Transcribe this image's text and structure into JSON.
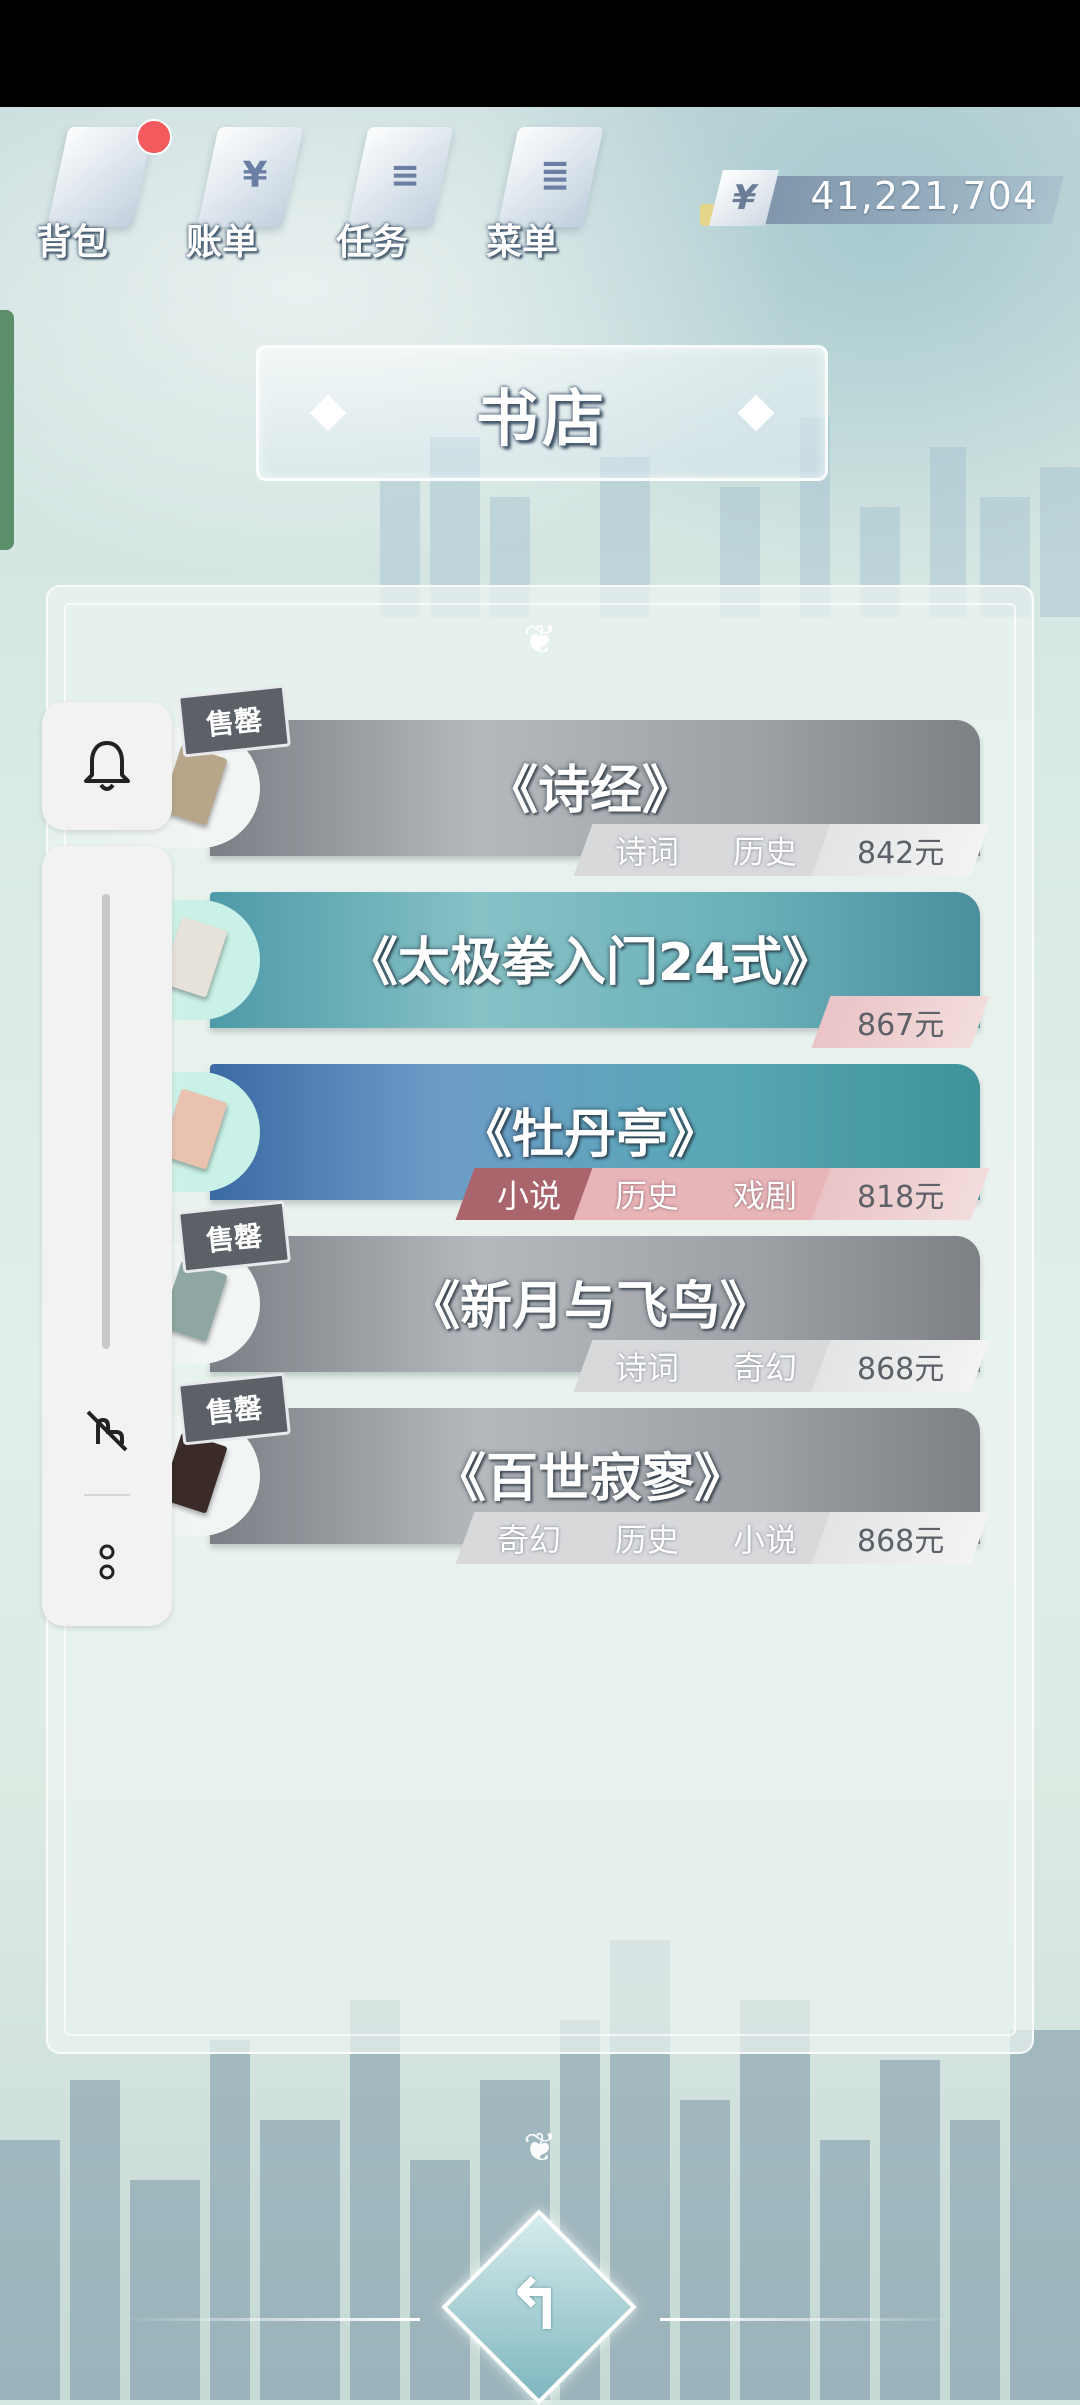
{
  "topnav": [
    {
      "label": "背包",
      "icon": "backpack-icon",
      "glyph": "",
      "has_badge": true
    },
    {
      "label": "账单",
      "icon": "bill-icon",
      "glyph": "¥",
      "has_badge": false
    },
    {
      "label": "任务",
      "icon": "task-icon",
      "glyph": "≡",
      "has_badge": false
    },
    {
      "label": "菜单",
      "icon": "menu-icon",
      "glyph": "≣",
      "has_badge": false
    }
  ],
  "money": {
    "currency_symbol": "¥",
    "amount": "41,221,704"
  },
  "page_title": "书店",
  "books": [
    {
      "title": "《诗经》",
      "tags": [
        "诗词",
        "历史"
      ],
      "price": "842元",
      "sold_out_label": "售罄",
      "style": "gray"
    },
    {
      "title": "《太极拳入门24式》",
      "tags": [],
      "price": "867元",
      "sold_out_label": "",
      "style": "teal"
    },
    {
      "title": "《牡丹亭》",
      "tags": [
        "小说",
        "历史",
        "戏剧"
      ],
      "price": "818元",
      "sold_out_label": "",
      "style": "blue"
    },
    {
      "title": "《新月与飞鸟》",
      "tags": [
        "诗词",
        "奇幻"
      ],
      "price": "868元",
      "sold_out_label": "售罄",
      "style": "gray"
    },
    {
      "title": "《百世寂寥》",
      "tags": [
        "奇幻",
        "历史",
        "小说"
      ],
      "price": "868元",
      "sold_out_label": "售罄",
      "style": "gray"
    }
  ],
  "colors": {
    "tag_dark": "#a9646c",
    "badge_red": "#f25a5e",
    "sold_badge": "#5c6167"
  }
}
